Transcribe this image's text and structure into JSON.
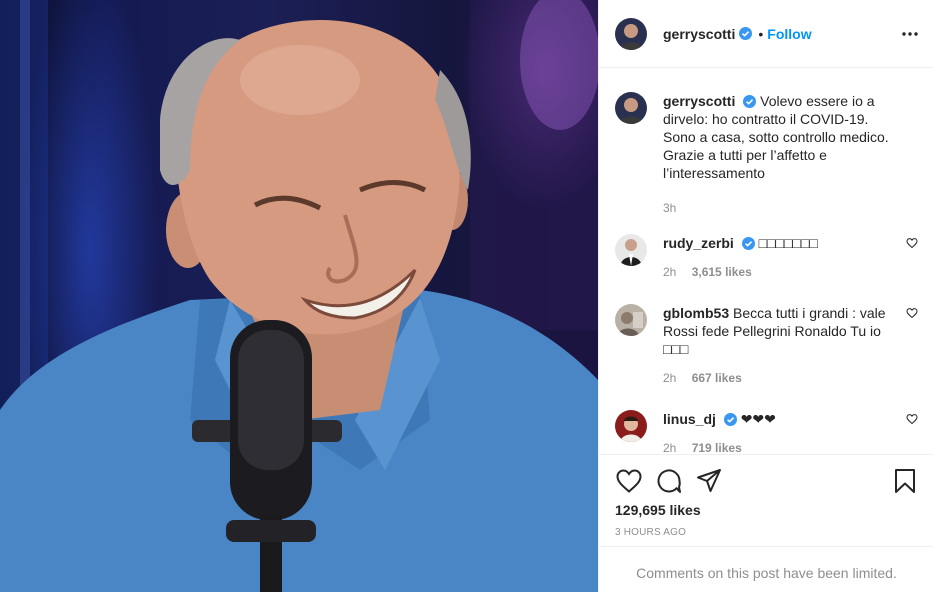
{
  "post": {
    "author": "gerryscotti",
    "follow_label": "Follow",
    "dot": "•",
    "caption": {
      "username": "gerryscotti",
      "text": "Volevo essere io a dirvelo: ho contratto il COVID-19. Sono a casa, sotto controllo medico. Grazie a tutti per l’affetto e l’interessamento",
      "time": "3h"
    },
    "comments": [
      {
        "username": "rudy_zerbi",
        "verified": true,
        "text": "□□□□□□□",
        "time": "2h",
        "likes": "3,615 likes"
      },
      {
        "username": "gblomb53",
        "verified": false,
        "text": "Becca tutti i grandi : vale Rossi fede Pellegrini Ronaldo Tu io □□□",
        "time": "2h",
        "likes": "667 likes"
      },
      {
        "username": "linus_dj",
        "verified": true,
        "text": "❤❤❤",
        "time": "2h",
        "likes": "719 likes"
      }
    ],
    "likes_total": "129,695 likes",
    "posted": "3 HOURS AGO",
    "comments_limited": "Comments on this post have been limited."
  },
  "icons": {
    "verified": "verified-badge-icon",
    "more": "more-options-icon",
    "like": "heart-icon",
    "comment": "comment-icon",
    "share": "share-icon",
    "save": "bookmark-icon"
  },
  "colors": {
    "link_blue": "#0095f6",
    "verified_blue": "#3897f0",
    "muted": "#8e8e8e",
    "border": "#efefef",
    "shirt": "#4a86c5"
  }
}
